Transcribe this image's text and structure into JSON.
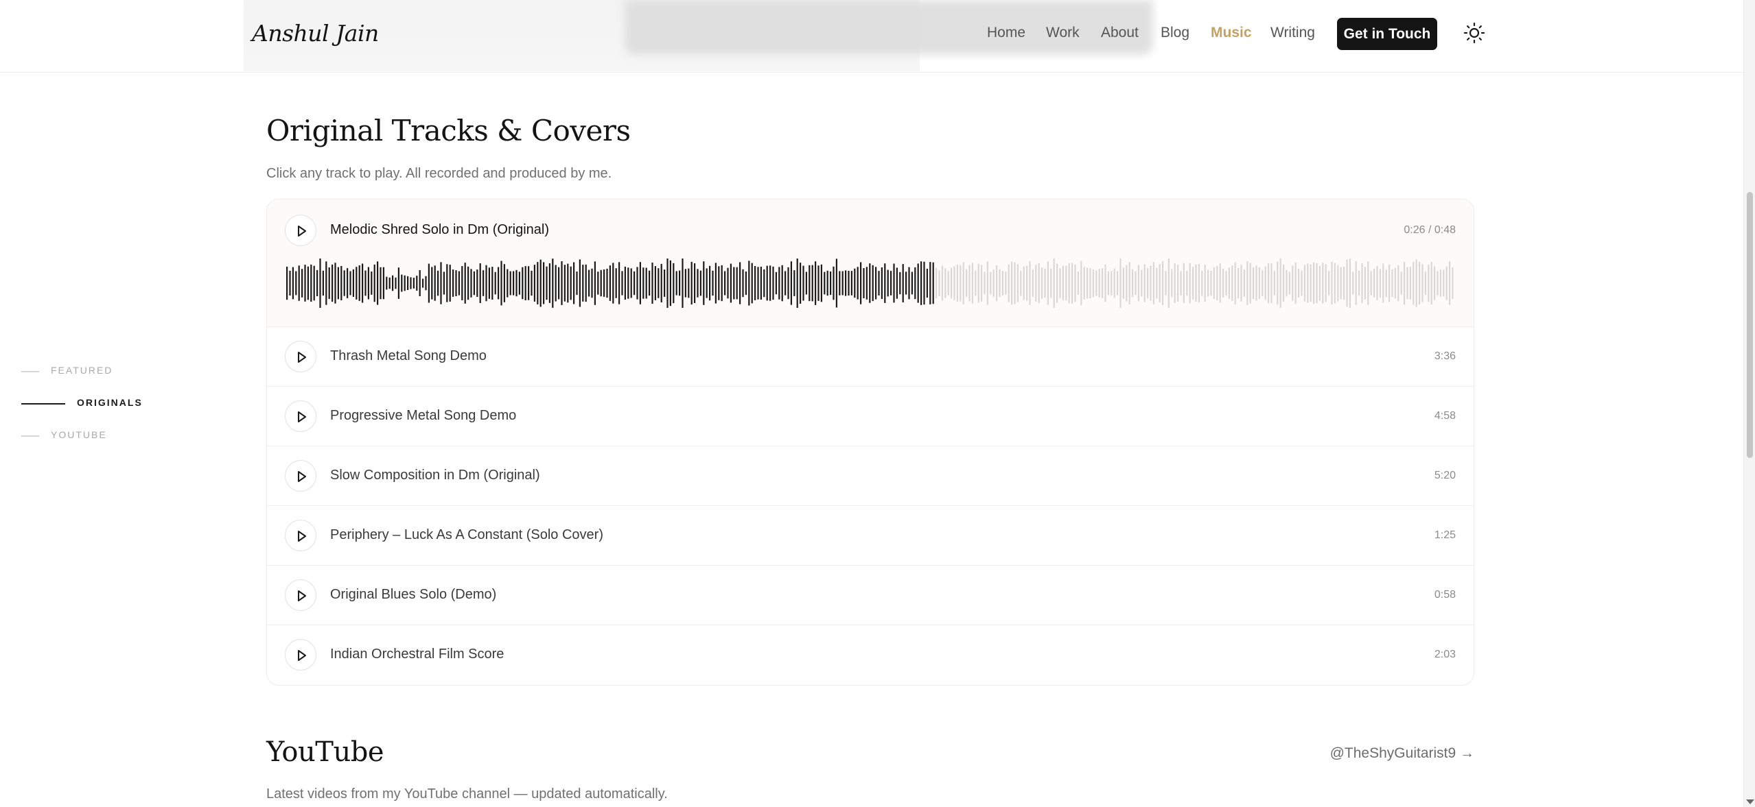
{
  "header": {
    "logo": "Anshul Jain",
    "nav": [
      {
        "label": "Home",
        "active": false
      },
      {
        "label": "Work",
        "active": false
      },
      {
        "label": "About",
        "active": false
      },
      {
        "label": "Blog",
        "active": false
      },
      {
        "label": "Music",
        "active": true
      },
      {
        "label": "Writing",
        "active": false
      }
    ],
    "cta": "Get in Touch",
    "theme_icon": "sun-icon",
    "accent_color": "#c5a063"
  },
  "sidenav": [
    {
      "label": "FEATURED",
      "active": false
    },
    {
      "label": "ORIGINALS",
      "active": true
    },
    {
      "label": "YOUTUBE",
      "active": false
    }
  ],
  "originals": {
    "title": "Original Tracks & Covers",
    "subtitle": "Click any track to play. All recorded and produced by me.",
    "now_playing": {
      "title": "Melodic Shred Solo in Dm (Original)",
      "time": "0:26 / 0:48",
      "progress": 0.553
    },
    "tracks": [
      {
        "title": "Thrash Metal Song Demo",
        "duration": "3:36"
      },
      {
        "title": "Progressive Metal Song Demo",
        "duration": "4:58"
      },
      {
        "title": "Slow Composition in Dm (Original)",
        "duration": "5:20"
      },
      {
        "title": "Periphery – Luck As A Constant (Solo Cover)",
        "duration": "1:25"
      },
      {
        "title": "Original Blues Solo (Demo)",
        "duration": "0:58"
      },
      {
        "title": "Indian Orchestral Film Score",
        "duration": "2:03"
      }
    ]
  },
  "youtube": {
    "title": "YouTube",
    "channel_link": "@TheShyGuitarist9 →",
    "subtitle": "Latest videos from my YouTube channel — updated automatically."
  }
}
